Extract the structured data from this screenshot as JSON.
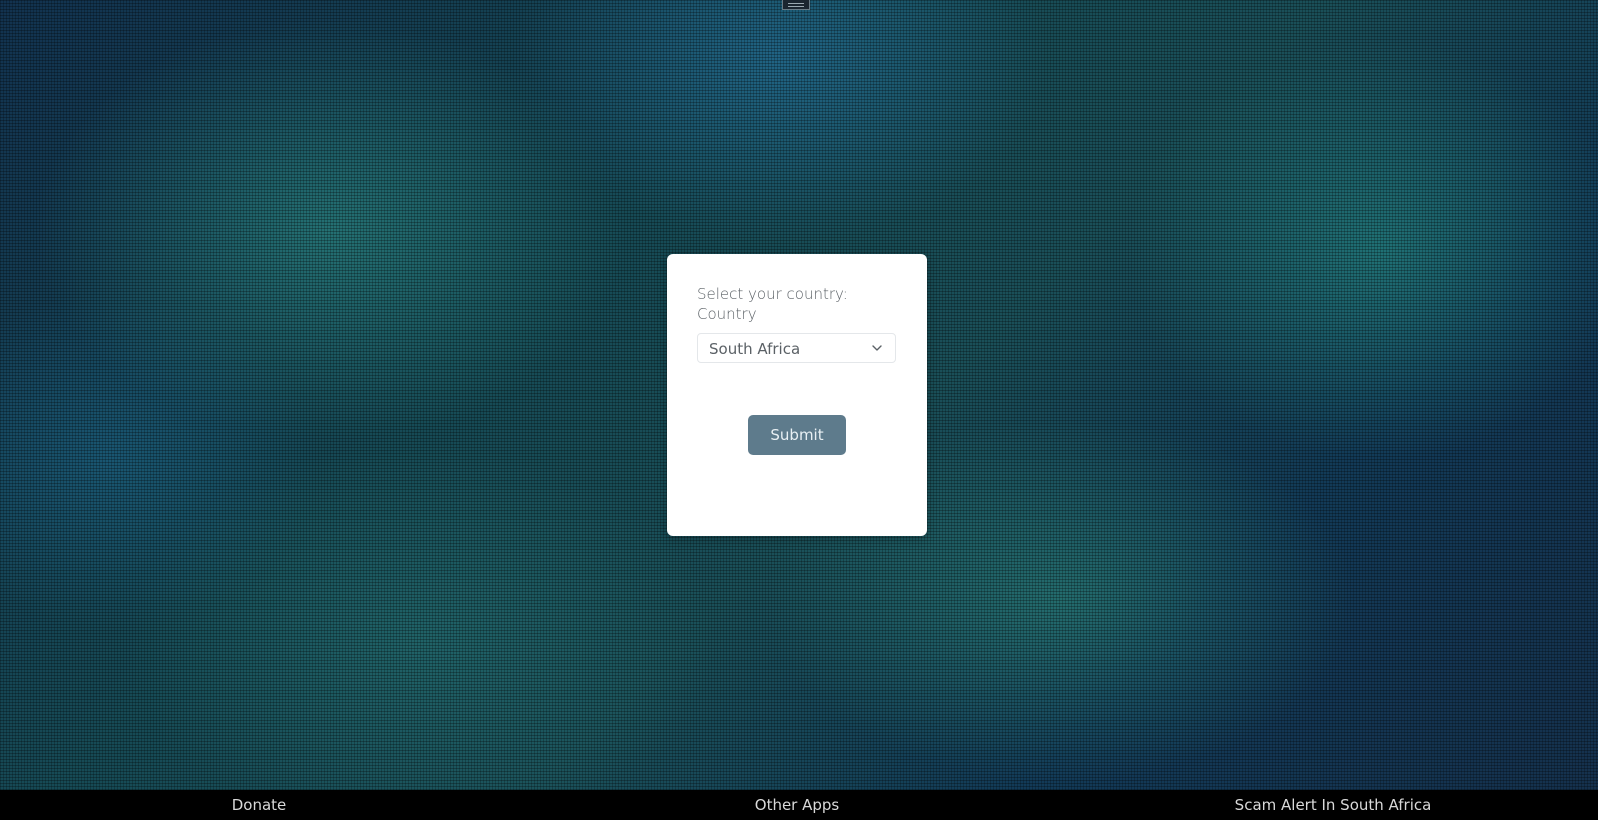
{
  "form": {
    "prompt_label": "Select your country:",
    "field_label": "Country",
    "country_select": {
      "selected_value": "South Africa"
    },
    "submit_label": "Submit"
  },
  "footer": {
    "links": [
      {
        "label": "Donate"
      },
      {
        "label": "Other Apps"
      },
      {
        "label": "Scam Alert In South Africa"
      }
    ]
  },
  "icons": {
    "dropdown": "chevron-down-icon",
    "handle": "drag-handle-icon"
  },
  "colors": {
    "button_bg": "#5e7b8c",
    "card_bg": "#ffffff",
    "footer_bg": "#000000"
  }
}
